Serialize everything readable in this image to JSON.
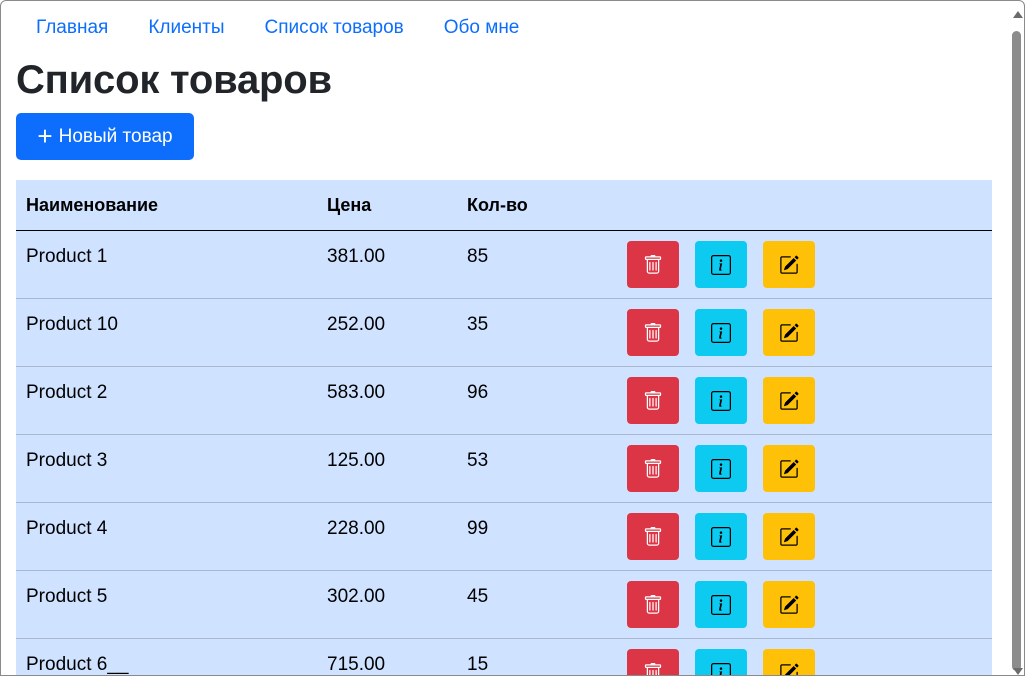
{
  "nav": {
    "items": [
      {
        "label": "Главная"
      },
      {
        "label": "Клиенты"
      },
      {
        "label": "Список товаров"
      },
      {
        "label": "Обо мне"
      }
    ]
  },
  "page": {
    "title": "Список товаров",
    "new_button_label": "Новый товар",
    "new_button_icon": "plus-icon"
  },
  "table": {
    "headers": [
      "Наименование",
      "Цена",
      "Кол-во",
      ""
    ],
    "rows": [
      {
        "name": "Product 1",
        "price": "381.00",
        "qty": "85"
      },
      {
        "name": "Product 10",
        "price": "252.00",
        "qty": "35"
      },
      {
        "name": "Product 2",
        "price": "583.00",
        "qty": "96"
      },
      {
        "name": "Product 3",
        "price": "125.00",
        "qty": "53"
      },
      {
        "name": "Product 4",
        "price": "228.00",
        "qty": "99"
      },
      {
        "name": "Product 5",
        "price": "302.00",
        "qty": "45"
      },
      {
        "name": "Product 6__",
        "price": "715.00",
        "qty": "15"
      }
    ],
    "row_actions": [
      {
        "icon": "trash-icon",
        "color": "#dc3545"
      },
      {
        "icon": "info-square-icon",
        "color": "#0dcaf0"
      },
      {
        "icon": "edit-square-icon",
        "color": "#ffc107"
      }
    ]
  },
  "colors": {
    "primary": "#0d6efd",
    "table_bg": "#cfe2ff",
    "danger": "#dc3545",
    "info": "#0dcaf0",
    "warning": "#ffc107"
  }
}
